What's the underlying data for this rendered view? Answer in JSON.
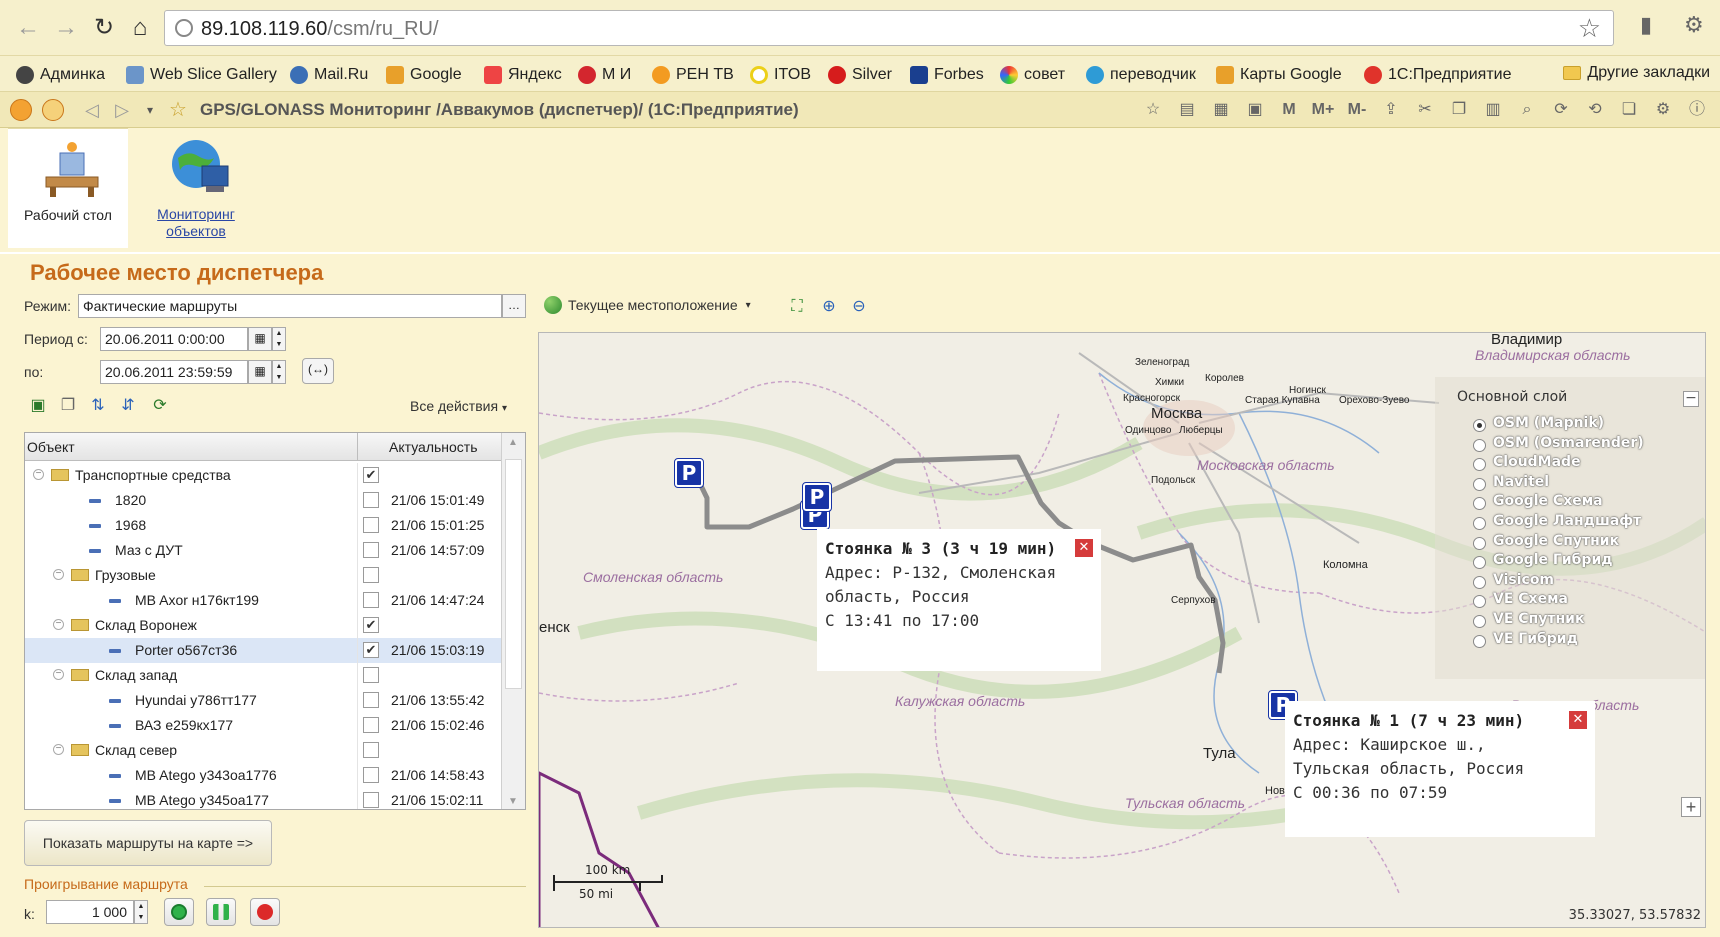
{
  "browser": {
    "url_host": "89.108.119.60",
    "url_path": "/csm/ru_RU/",
    "bookmarks": [
      "Админка",
      "Web Slice Gallery",
      "Mail.Ru",
      "Google",
      "Яндекс",
      "М И",
      "РЕН ТВ",
      "ITOB",
      "Silver",
      "Forbes",
      "совет",
      "переводчик",
      "Карты Google",
      "1С:Предприятие"
    ],
    "other_bookmarks": "Другие закладки",
    "tab_title": "GPS/GLONASS Мониторинг /Аввакумов (диспетчер)/ (1С:Предприятие)",
    "tool_labels": [
      "M",
      "M+",
      "M-"
    ]
  },
  "sections": [
    {
      "label": "Рабочий стол"
    },
    {
      "label": "Мониторинг объектов"
    }
  ],
  "page_title": "Рабочее место диспетчера",
  "filters": {
    "mode_label": "Режим:",
    "mode_value": "Фактические маршруты",
    "period_from_label": "Период с:",
    "period_from_value": "20.06.2011 0:00:00",
    "period_to_label": "по:",
    "period_to_value": "20.06.2011 23:59:59",
    "period_btn": "(↔)",
    "all_actions": "Все действия"
  },
  "tree": {
    "col_object": "Объект",
    "col_actual": "Актуальность",
    "rows": [
      {
        "name": "Транспортные средства",
        "level": 0,
        "type": "folder",
        "checked": "on",
        "date": ""
      },
      {
        "name": "1820",
        "level": 1,
        "type": "item",
        "checked": "off",
        "date": "21/06 15:01:49"
      },
      {
        "name": "1968",
        "level": 1,
        "type": "item",
        "checked": "off",
        "date": "21/06 15:01:25"
      },
      {
        "name": "Маз с ДУТ",
        "level": 1,
        "type": "item",
        "checked": "off",
        "date": "21/06 14:57:09"
      },
      {
        "name": "Грузовые",
        "level": 1,
        "type": "folder",
        "checked": "off",
        "date": ""
      },
      {
        "name": "MB Axor н176кт199",
        "level": 2,
        "type": "item",
        "checked": "off",
        "date": "21/06 14:47:24"
      },
      {
        "name": "Склад Воронеж",
        "level": 1,
        "type": "folder",
        "checked": "on",
        "date": ""
      },
      {
        "name": "Porter о567ст36",
        "level": 2,
        "type": "item",
        "checked": "on",
        "date": "21/06 15:03:19",
        "selected": true
      },
      {
        "name": "Склад запад",
        "level": 1,
        "type": "folder",
        "checked": "off",
        "date": ""
      },
      {
        "name": "Hyundai у786тт177",
        "level": 2,
        "type": "item",
        "checked": "off",
        "date": "21/06 13:55:42"
      },
      {
        "name": "ВАЗ е259кх177",
        "level": 2,
        "type": "item",
        "checked": "off",
        "date": "21/06 15:02:46"
      },
      {
        "name": "Склад север",
        "level": 1,
        "type": "folder",
        "checked": "off",
        "date": ""
      },
      {
        "name": "MB Atego у343оа1776",
        "level": 2,
        "type": "item",
        "checked": "off",
        "date": "21/06 14:58:43"
      },
      {
        "name": "MB Atego у345оа177",
        "level": 2,
        "type": "item",
        "checked": "off",
        "date": "21/06 15:02:11"
      }
    ]
  },
  "show_routes_btn": "Показать маршруты на карте =>",
  "replay": {
    "label": "Проигрывание маршрута",
    "k_label": "k:",
    "k_value": "1 000"
  },
  "map": {
    "current_location": "Текущее местоположение",
    "places": [
      "Владимир",
      "Владимирская область",
      "Зеленоград",
      "Химки",
      "Королев",
      "Красногорск",
      "Старая Купавна",
      "Ногинск",
      "Орехово-Зуево",
      "Москва",
      "Одинцово",
      "Люберцы",
      "Московская область",
      "Подольск",
      "Смоленская область",
      "Коломна",
      "Серпухов",
      "Калужская область",
      "Рязанская область",
      "Тула",
      "Тульская область",
      "енск",
      "Нов"
    ],
    "popups": [
      {
        "title": "Стоянка № 3 (3 ч 19 мин)",
        "address": "Адрес: Р-132, Смоленская",
        "address2": "область, Россия",
        "time": "С 13:41 по 17:00"
      },
      {
        "title": "Стоянка № 1 (7 ч 23 мин)",
        "address": "Адрес: Каширское ш.,",
        "address2": "Тульская область, Россия",
        "time": "С 00:36 по 07:59"
      }
    ],
    "layers_title": "Основной слой",
    "layers": [
      "OSM (Mapnik)",
      "OSM (Osmarender)",
      "CloudMade",
      "Navitel",
      "Google Схема",
      "Google Ландшафт",
      "Google Спутник",
      "Google Гибрид",
      "Visicom",
      "VE Схема",
      "VE Спутник",
      "VE Гибрид"
    ],
    "selected_layer": "OSM (Mapnik)",
    "scale_km": "100 km",
    "scale_mi": "50 mi",
    "coords": "35.33027, 53.57832",
    "parking_marker": "P"
  }
}
